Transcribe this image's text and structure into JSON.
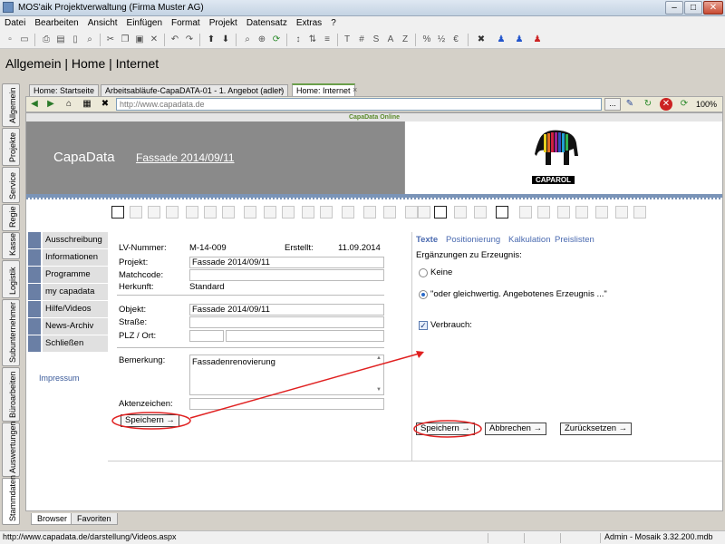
{
  "window": {
    "title": "MOS'aik Projektverwaltung (Firma Muster AG)",
    "btn_min": "–",
    "btn_max": "□",
    "btn_close": "✕"
  },
  "menu": [
    "Datei",
    "Bearbeiten",
    "Ansicht",
    "Einfügen",
    "Format",
    "Projekt",
    "Datensatz",
    "Extras",
    "?"
  ],
  "heading": "Allgemein | Home | Internet",
  "left_tabs": [
    "Allgemein",
    "Projekte",
    "Service",
    "Regie",
    "Kasse",
    "Logistik",
    "Subunternehmer",
    "Büroarbeiten",
    "Auswertungen",
    "Stammdaten"
  ],
  "doc_tabs": [
    "Home: Startseite",
    "Arbeitsabläufe-CapaDATA-01 - 1. Angebot (adler)",
    "Home: Internet"
  ],
  "doc_tab_close": "×",
  "nav": {
    "url": "http://www.capadata.de",
    "dots": "...",
    "zoom": "100%"
  },
  "page": {
    "online_label": "CapaData Online",
    "brand": "CapaData",
    "project_link": "Fassade 2014/09/11",
    "logo_text": "CAPAROL",
    "sidenav": [
      "Ausschreibung",
      "Informationen",
      "Programme",
      "my capadata",
      "Hilfe/Videos",
      "News-Archiv",
      "Schließen"
    ],
    "impressum": "Impressum"
  },
  "form": {
    "lv_label": "LV-Nummer:",
    "lv_value": "M-14-009",
    "created_label": "Erstellt:",
    "created_value": "11.09.2014",
    "projekt_label": "Projekt:",
    "projekt_value": "Fassade 2014/09/11",
    "matchcode_label": "Matchcode:",
    "matchcode_value": "",
    "herkunft_label": "Herkunft:",
    "herkunft_value": "Standard",
    "objekt_label": "Objekt:",
    "objekt_value": "Fassade 2014/09/11",
    "strasse_label": "Straße:",
    "strasse_value": "",
    "plz_label": "PLZ / Ort:",
    "plz_value": "",
    "ort_value": "",
    "bemerkung_label": "Bemerkung:",
    "bemerkung_value": "Fassadenrenovierung",
    "aktenzeichen_label": "Aktenzeichen:",
    "aktenzeichen_value": "",
    "save_label": "Speichern →"
  },
  "panel": {
    "tabs": [
      "Texte",
      "Positionierung",
      "Kalkulation",
      "Preislisten"
    ],
    "section_title": "Ergänzungen zu Erzeugnis:",
    "option_none": "Keine",
    "option_equiv": "\"oder gleichwertig. Angebotenes Erzeugnis ...\"",
    "verbrauch_label": "Verbrauch:",
    "save_label": "Speichern →",
    "cancel_label": "Abbrechen →",
    "reset_label": "Zurücksetzen →"
  },
  "bottom_tabs": [
    "Browser",
    "Favoriten"
  ],
  "status": {
    "url": "http://www.capadata.de/darstellung/Videos.aspx",
    "db": "Admin - Mosaik 3.32.200.mdb"
  },
  "colors": {
    "annotation": "#e02020",
    "banner": "#8a8a8a",
    "nav_square": "#6a7fa5",
    "link": "#4a6ab0"
  }
}
